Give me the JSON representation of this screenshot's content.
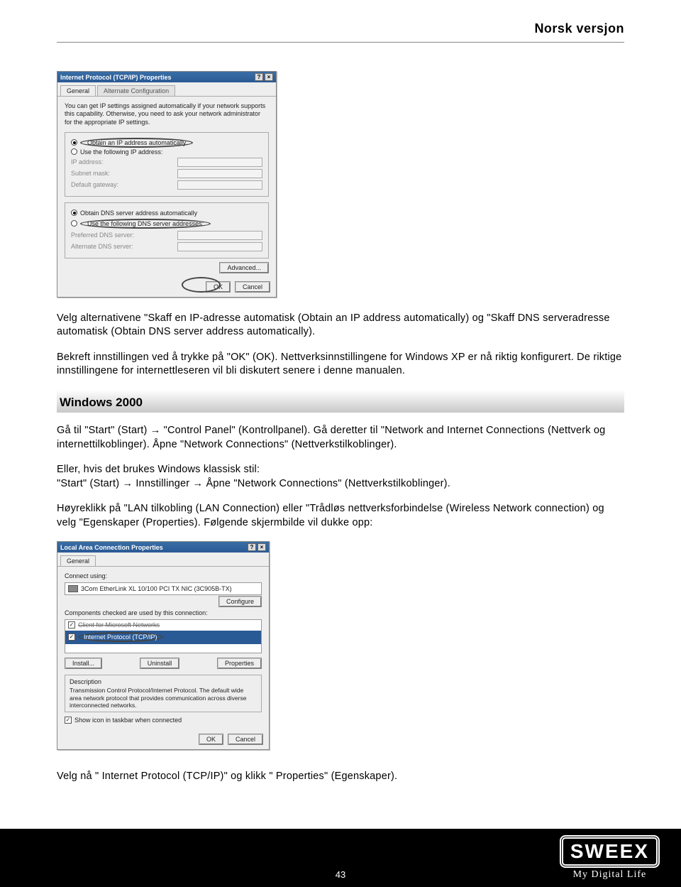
{
  "header": {
    "corner": "Norsk versjon"
  },
  "dialog1": {
    "title": "Internet Protocol (TCP/IP) Properties",
    "help_btn": "?",
    "close_btn": "×",
    "tab_general": "General",
    "tab_alt": "Alternate Configuration",
    "intro": "You can get IP settings assigned automatically if your network supports this capability. Otherwise, you need to ask your network administrator for the appropriate IP settings.",
    "r1": "Obtain an IP address automatically",
    "r2": "Use the following IP address:",
    "ip_label": "IP address:",
    "mask_label": "Subnet mask:",
    "gw_label": "Default gateway:",
    "r3": "Obtain DNS server address automatically",
    "r4": "Use the following DNS server addresses:",
    "pref_dns": "Preferred DNS server:",
    "alt_dns": "Alternate DNS server:",
    "adv_btn": "Advanced...",
    "ok": "OK",
    "cancel": "Cancel"
  },
  "para1": "Velg alternativene \"Skaff en IP-adresse automatisk (Obtain an IP address automatically) og \"Skaff DNS serveradresse automatisk (Obtain DNS server address automatically).",
  "para2": "Bekreft innstillingen ved å trykke på \"OK\" (OK). Nettverksinnstillingene for Windows XP er nå riktig konfigurert. De riktige innstillingene for internettleseren vil bli diskutert senere i denne manualen.",
  "section_head": "Windows 2000",
  "para3": "Gå til \"Start\" (Start) → \"Control Panel\" (Kontrollpanel). Gå deretter til \"Network and Internet Connections (Nettverk og internettilkoblinger). Åpne \"Network Connections\" (Nettverkstilkoblinger).",
  "para4a": "Eller, hvis det brukes Windows klassisk stil:",
  "para4b": "\"Start\" (Start) → Innstillinger → Åpne \"Network Connections\" (Nettverkstilkoblinger).",
  "para5": "Høyreklikk på \"LAN tilkobling (LAN Connection) eller \"Trådløs nettverksforbindelse (Wireless Network connection) og velg \"Egenskaper (Properties). Følgende skjermbilde vil dukke opp:",
  "dialog2": {
    "title": "Local Area Connection Properties",
    "help_btn": "?",
    "close_btn": "×",
    "tab_general": "General",
    "connect_using": "Connect using:",
    "nic": "3Com EtherLink XL 10/100 PCI TX NIC (3C905B-TX)",
    "configure": "Configure",
    "components_label": "Components checked are used by this connection:",
    "item1": "Client for Microsoft Networks",
    "item2": "Internet Protocol (TCP/IP)",
    "install": "Install...",
    "uninstall": "Uninstall",
    "properties": "Properties",
    "desc_head": "Description",
    "desc_text": "Transmission Control Protocol/Internet Protocol. The default wide area network protocol that provides communication across diverse interconnected networks.",
    "show_icon": "Show icon in taskbar when connected",
    "ok": "OK",
    "cancel": "Cancel"
  },
  "para6": "Velg nå \" Internet Protocol (TCP/IP)\" og klikk \" Properties\" (Egenskaper).",
  "footer": {
    "page": "43",
    "logo_main": "SWEEX",
    "logo_sub": "My Digital Life"
  }
}
